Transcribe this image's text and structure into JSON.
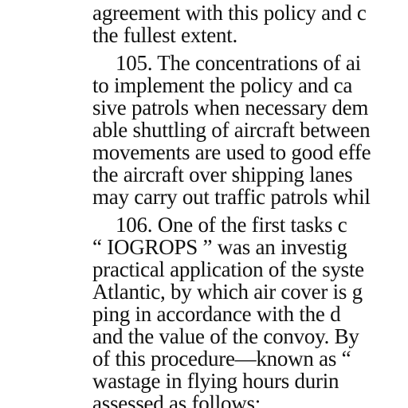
{
  "document": {
    "paragraphs": [
      {
        "lines": [
          "agreement with this policy and c",
          "the fullest extent."
        ]
      },
      {
        "lines": [
          "105. The concentrations of ai",
          "to implement the policy and ca",
          "sive patrols when necessary dem",
          "able shuttling of aircraft between",
          "movements are used to good effe",
          "the aircraft over shipping lanes",
          "may carry out traffic patrols whil"
        ]
      },
      {
        "lines": [
          "106. One of the first tasks c",
          "“ IOGROPS ” was an investig",
          "practical application of the syste",
          "Atlantic, by which air cover is g",
          "ping in accordance with the d",
          "and the value of the convoy. By",
          "of this procedure—known as “",
          "wastage in flying hours durin",
          "assessed as follows:"
        ]
      }
    ]
  }
}
